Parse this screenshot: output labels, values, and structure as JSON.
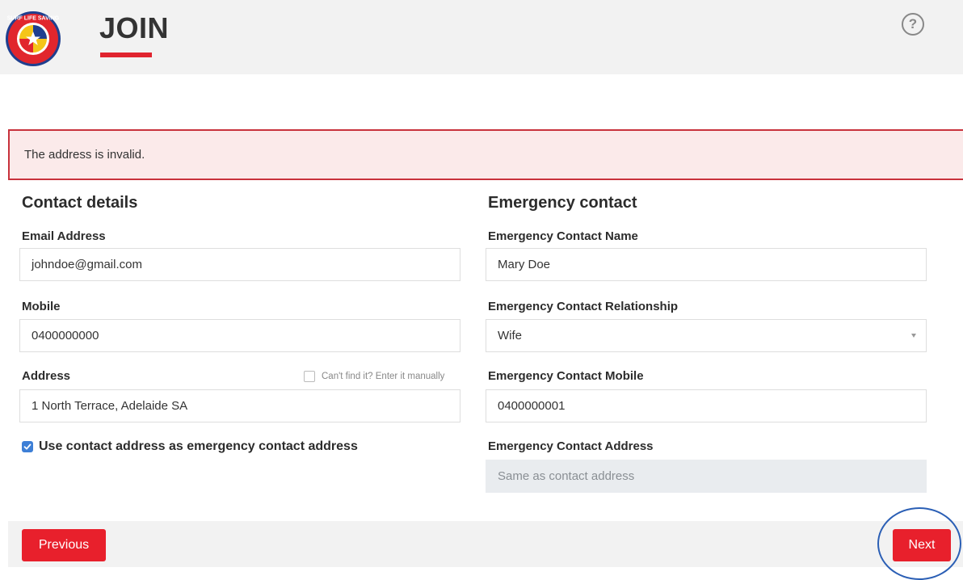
{
  "header": {
    "title": "JOIN",
    "logo_text": "SURF LIFE SAVING",
    "help_icon": "question-circle-icon"
  },
  "alert": {
    "message": "The address is invalid."
  },
  "contact": {
    "section_title": "Contact details",
    "email_label": "Email Address",
    "email_value": "johndoe@gmail.com",
    "mobile_label": "Mobile",
    "mobile_value": "0400000000",
    "address_label": "Address",
    "manual_label": "Can't find it? Enter it manually",
    "address_value": "1 North Terrace, Adelaide SA",
    "use_contact_label": "Use contact address as emergency contact address"
  },
  "emergency": {
    "section_title": "Emergency contact",
    "name_label": "Emergency Contact Name",
    "name_value": "Mary Doe",
    "relationship_label": "Emergency Contact Relationship",
    "relationship_value": "Wife",
    "mobile_label": "Emergency Contact Mobile",
    "mobile_value": "0400000001",
    "address_label": "Emergency Contact Address",
    "address_placeholder": "Same as contact address"
  },
  "footer": {
    "previous_label": "Previous",
    "next_label": "Next"
  },
  "colors": {
    "brand_red": "#e8202c",
    "alert_border": "#c8323c",
    "alert_bg": "#fbeaea",
    "checkbox_blue": "#3d7fd6"
  }
}
